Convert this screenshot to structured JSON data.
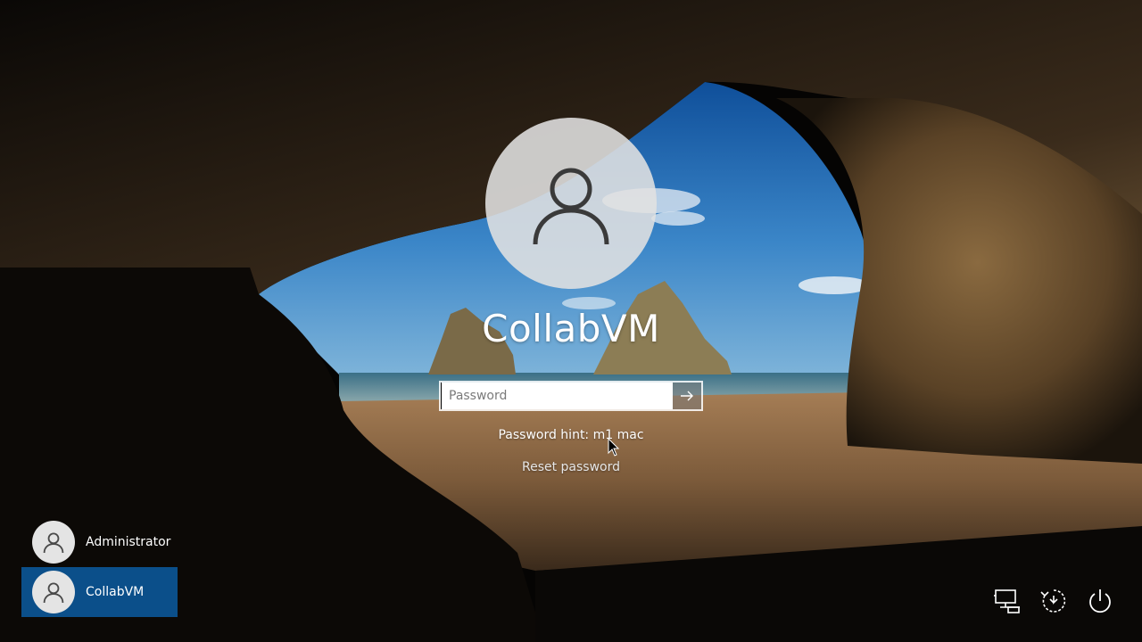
{
  "login": {
    "user_name": "CollabVM",
    "password_placeholder": "Password",
    "password_value": "",
    "password_hint": "Password hint: m1 mac",
    "reset_password_label": "Reset password"
  },
  "user_list": [
    {
      "name": "Administrator",
      "selected": false,
      "icon": "user-icon"
    },
    {
      "name": "CollabVM",
      "selected": true,
      "icon": "user-icon"
    }
  ],
  "corner_actions": [
    {
      "icon": "network-icon"
    },
    {
      "icon": "ease-of-access-icon"
    },
    {
      "icon": "power-icon"
    }
  ],
  "colors": {
    "selected_user_bg": "#0b4f8a",
    "text": "#ffffff",
    "avatar_bg": "#e4e4e4"
  }
}
